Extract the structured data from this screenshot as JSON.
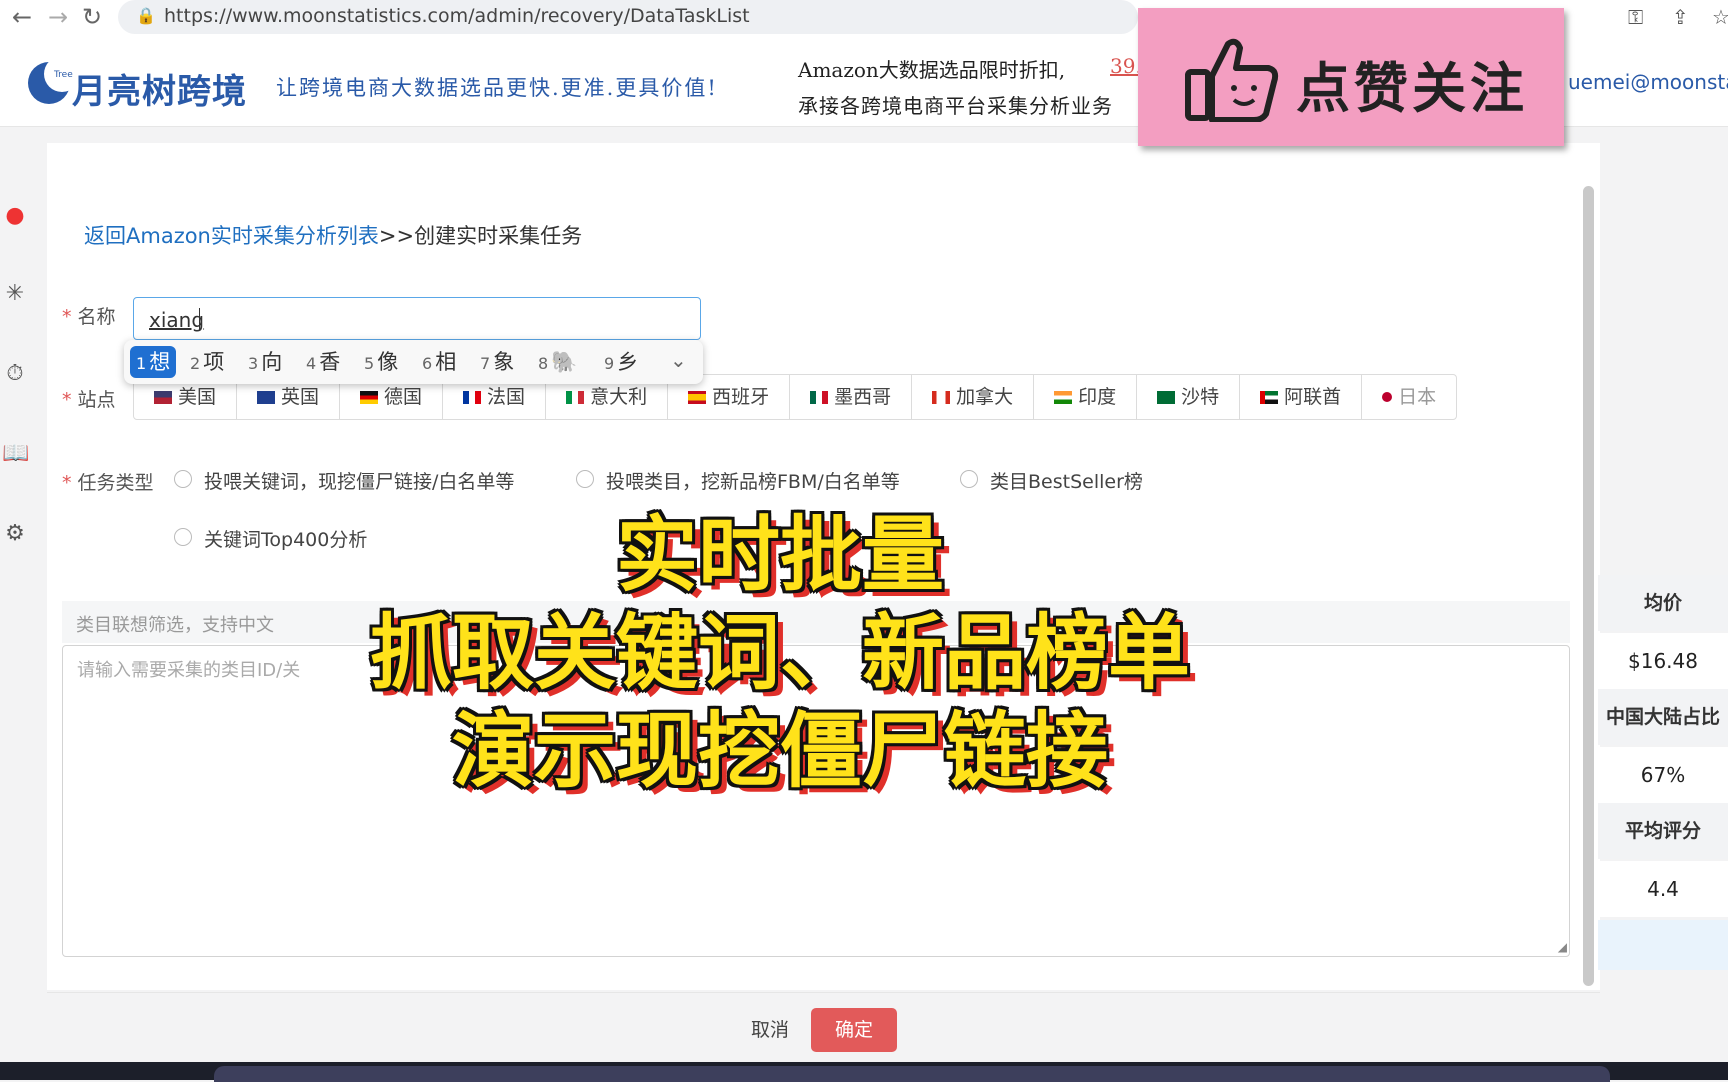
{
  "browser": {
    "url": "https://www.moonstatistics.com/admin/recovery/DataTaskList",
    "icons": [
      "back-icon",
      "forward-icon",
      "reload-icon",
      "lock-icon",
      "key-icon",
      "share-icon",
      "star-icon"
    ]
  },
  "site": {
    "logo_small": "Tree",
    "logo": "月亮树跨境",
    "slogan": "让跨境电商大数据选品更快.更准.更具价值!",
    "promo_line1": "Amazon大数据选品限时折扣,",
    "promo_num": "39.",
    "promo_line2": "承接各跨境电商平台采集分析业务",
    "email": "uemei@moonstat"
  },
  "sticker": {
    "text": "点赞关注",
    "color": "#f39ec1"
  },
  "sidebar": {
    "icons": [
      "bulb-icon",
      "sparkle-icon",
      "timer-icon",
      "book-icon",
      "gear-icon"
    ]
  },
  "breadcrumb": {
    "link": "返回Amazon实时采集分析列表",
    "rest": ">>创建实时采集任务"
  },
  "form": {
    "required_mark": "*",
    "name_label": "名称",
    "name_value": "xiang",
    "site_label": "站点",
    "task_type_label": "任务类型",
    "sites": [
      {
        "label": "美国"
      },
      {
        "label": "英国"
      },
      {
        "label": "德国"
      },
      {
        "label": "法国"
      },
      {
        "label": "意大利"
      },
      {
        "label": "西班牙"
      },
      {
        "label": "墨西哥"
      },
      {
        "label": "加拿大"
      },
      {
        "label": "印度"
      },
      {
        "label": "沙特"
      },
      {
        "label": "阿联酋"
      },
      {
        "label": "日本"
      }
    ],
    "task_types": [
      "投喂关键词，现挖僵尸链接/白名单等",
      "投喂类目，挖新品榜FBM/白名单等",
      "类目BestSeller榜",
      "关键词Top400分析"
    ],
    "category_filter_placeholder": "类目联想筛选，支持中文",
    "textarea_placeholder": "请输入需要采集的类目ID/关",
    "cancel": "取消",
    "confirm": "确定"
  },
  "ime": {
    "candidates": [
      {
        "n": "1",
        "t": "想"
      },
      {
        "n": "2",
        "t": "项"
      },
      {
        "n": "3",
        "t": "向"
      },
      {
        "n": "4",
        "t": "香"
      },
      {
        "n": "5",
        "t": "像"
      },
      {
        "n": "6",
        "t": "相"
      },
      {
        "n": "7",
        "t": "象"
      },
      {
        "n": "8",
        "t": "🐘"
      },
      {
        "n": "9",
        "t": "乡"
      }
    ]
  },
  "stats": [
    {
      "label": "均价",
      "value": "$16.48"
    },
    {
      "label": "中国大陆占比",
      "value": "67%"
    },
    {
      "label": "平均评分",
      "value": "4.4"
    }
  ],
  "caption": {
    "line1": "实时批量",
    "line2": "抓取关键词、新品榜单",
    "line3": "演示现挖僵尸链接"
  },
  "colors": {
    "primary": "#1f6fc0",
    "danger": "#e25a5a",
    "caption": "#ffe21a"
  }
}
